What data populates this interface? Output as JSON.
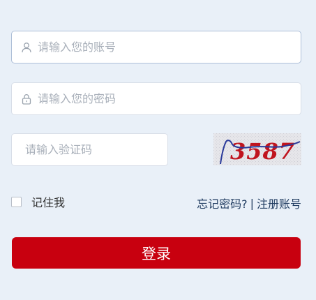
{
  "form": {
    "username": {
      "value": "",
      "placeholder": "请输入您的账号",
      "icon": "user-icon"
    },
    "password": {
      "value": "",
      "placeholder": "请输入您的密码",
      "icon": "lock-icon"
    },
    "captcha": {
      "value": "",
      "placeholder": "请输入验证码"
    },
    "captcha_image": {
      "text": "3587"
    },
    "remember_me": {
      "label": "记住我",
      "checked": false
    },
    "links": {
      "forgot_password": "忘记密码?",
      "separator": "|",
      "register": "注册账号"
    },
    "login_button": "登录"
  },
  "colors": {
    "background": "#e9f0f8",
    "primary": "#c8000f",
    "link": "#1e3a5f",
    "captcha_text": "#c0141e",
    "captcha_line": "#2a3a9a"
  }
}
